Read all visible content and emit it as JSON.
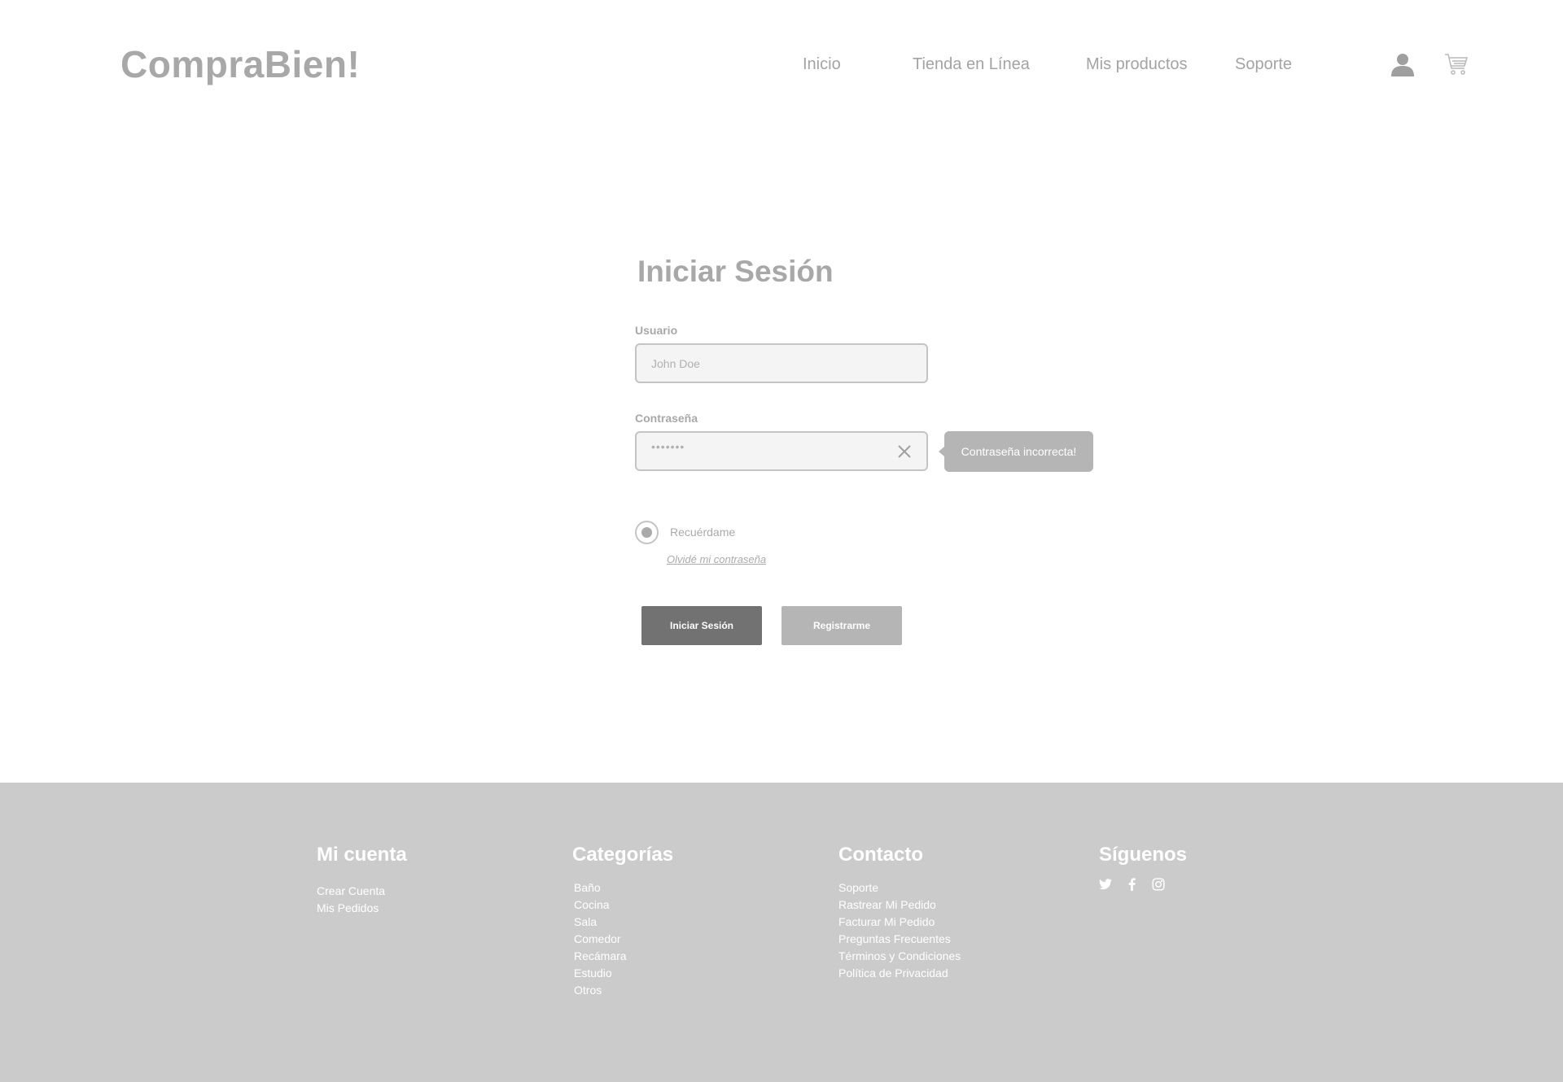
{
  "header": {
    "logo": "CompraBien!",
    "nav": [
      {
        "label": "Inicio"
      },
      {
        "label": "Tienda en Línea"
      },
      {
        "label": "Mis productos"
      },
      {
        "label": "Soporte"
      }
    ],
    "icons": [
      "user-icon",
      "cart-icon"
    ]
  },
  "login": {
    "title": "Iniciar Sesión",
    "username_label": "Usuario",
    "username_placeholder": "John Doe",
    "password_label": "Contraseña",
    "password_mask": "•••••••",
    "error_tooltip": "Contraseña incorrecta!",
    "remember_label": "Recuérdame",
    "remember_checked": true,
    "forgot_link": "Olvidé mi contraseña",
    "login_button": "Iniciar Sesión",
    "register_button": "Registrarme"
  },
  "footer": {
    "account": {
      "heading": "Mi cuenta",
      "links": [
        "Crear Cuenta",
        "Mis Pedidos"
      ]
    },
    "categories": {
      "heading": "Categorías",
      "links": [
        "Baño",
        "Cocina",
        "Sala",
        "Comedor",
        "Recámara",
        "Estudio",
        "Otros"
      ]
    },
    "contact": {
      "heading": "Contacto",
      "links": [
        "Soporte",
        "Rastrear Mi Pedido",
        "Facturar Mi Pedido",
        "Preguntas Frecuentes",
        "Términos y Condiciones",
        "Política de Privacidad"
      ]
    },
    "social": {
      "heading": "Síguenos",
      "icons": [
        "twitter-icon",
        "facebook-icon",
        "instagram-icon"
      ]
    }
  },
  "colors": {
    "text_gray": "#a8a8a8",
    "footer_bg": "#cbcbcb",
    "login_button_bg": "#727272",
    "register_button_bg": "#b5b5b5",
    "input_bg": "#f4f4f4"
  }
}
